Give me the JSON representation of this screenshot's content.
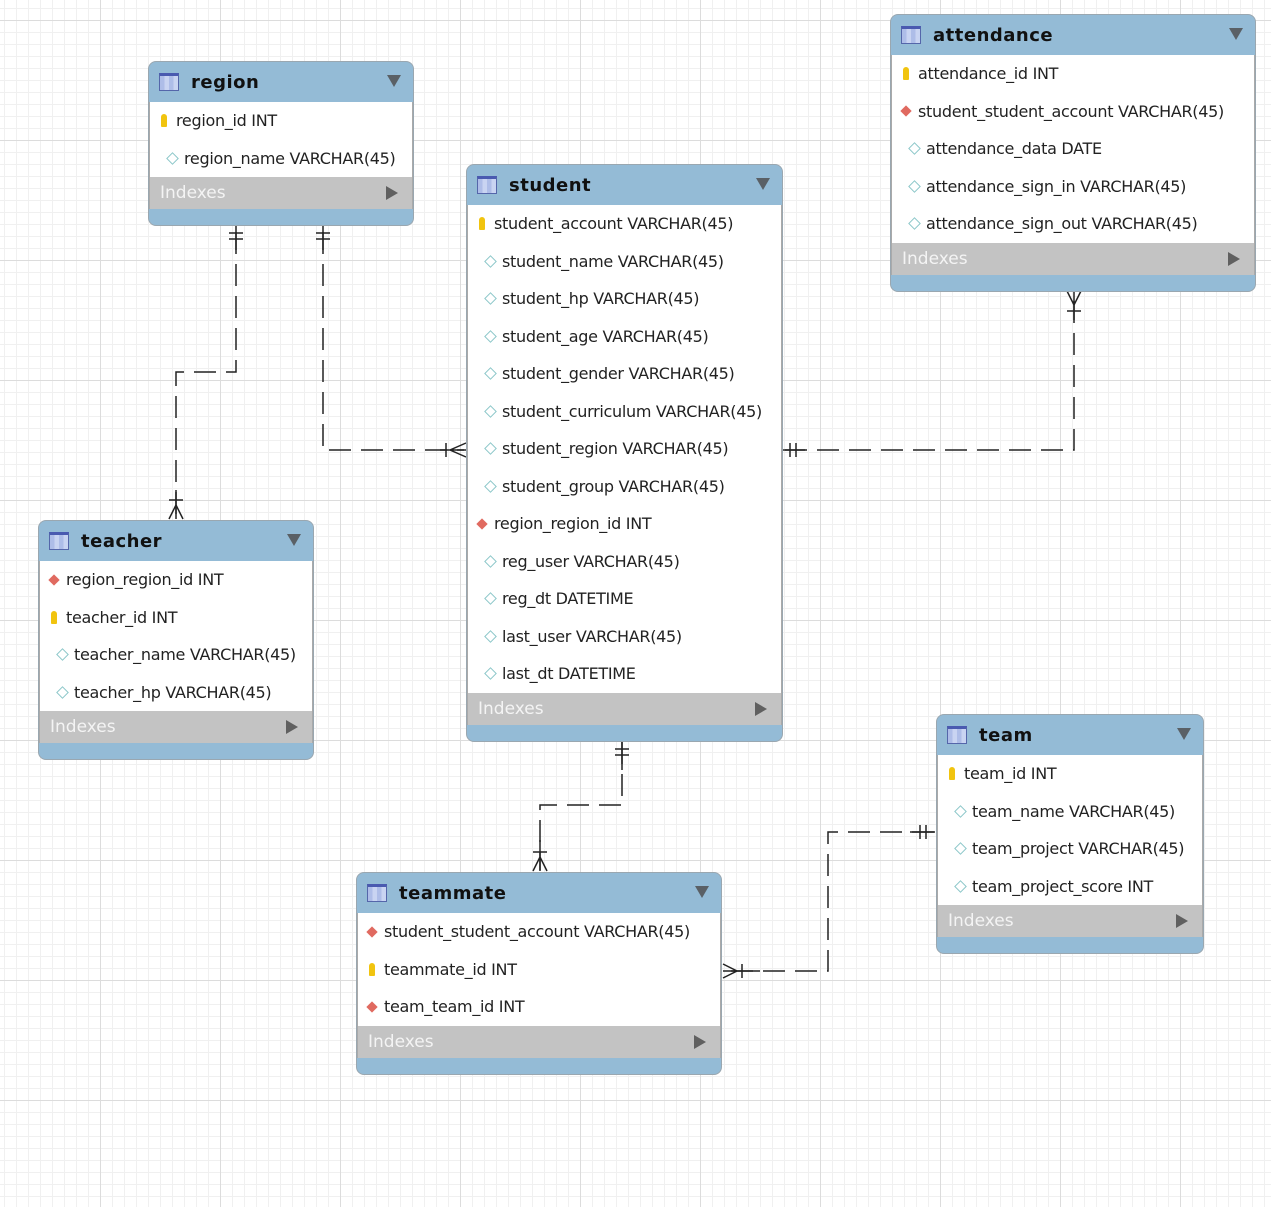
{
  "tables": [
    {
      "id": "region",
      "name": "region",
      "indexes_label": "Indexes",
      "columns": [
        {
          "icon": "key",
          "text": "region_id INT"
        },
        {
          "icon": "column",
          "text": "region_name VARCHAR(45)"
        }
      ]
    },
    {
      "id": "student",
      "name": "student",
      "indexes_label": "Indexes",
      "columns": [
        {
          "icon": "key",
          "text": "student_account VARCHAR(45)"
        },
        {
          "icon": "column",
          "text": "student_name VARCHAR(45)"
        },
        {
          "icon": "column",
          "text": "student_hp VARCHAR(45)"
        },
        {
          "icon": "column",
          "text": "student_age VARCHAR(45)"
        },
        {
          "icon": "column",
          "text": "student_gender VARCHAR(45)"
        },
        {
          "icon": "column",
          "text": "student_curriculum VARCHAR(45)"
        },
        {
          "icon": "column",
          "text": "student_region VARCHAR(45)"
        },
        {
          "icon": "column",
          "text": "student_group VARCHAR(45)"
        },
        {
          "icon": "foreign-key",
          "text": "region_region_id INT"
        },
        {
          "icon": "column",
          "text": "reg_user VARCHAR(45)"
        },
        {
          "icon": "column",
          "text": "reg_dt DATETIME"
        },
        {
          "icon": "column",
          "text": "last_user VARCHAR(45)"
        },
        {
          "icon": "column",
          "text": "last_dt DATETIME"
        }
      ]
    },
    {
      "id": "attendance",
      "name": "attendance",
      "indexes_label": "Indexes",
      "columns": [
        {
          "icon": "key",
          "text": "attendance_id INT"
        },
        {
          "icon": "foreign-key",
          "text": "student_student_account VARCHAR(45)"
        },
        {
          "icon": "column",
          "text": "attendance_data DATE"
        },
        {
          "icon": "column",
          "text": "attendance_sign_in VARCHAR(45)"
        },
        {
          "icon": "column",
          "text": "attendance_sign_out VARCHAR(45)"
        }
      ]
    },
    {
      "id": "teacher",
      "name": "teacher",
      "indexes_label": "Indexes",
      "columns": [
        {
          "icon": "foreign-key",
          "text": "region_region_id INT"
        },
        {
          "icon": "key",
          "text": "teacher_id INT"
        },
        {
          "icon": "column",
          "text": "teacher_name VARCHAR(45)"
        },
        {
          "icon": "column",
          "text": "teacher_hp VARCHAR(45)"
        }
      ]
    },
    {
      "id": "team",
      "name": "team",
      "indexes_label": "Indexes",
      "columns": [
        {
          "icon": "key",
          "text": "team_id INT"
        },
        {
          "icon": "column",
          "text": "team_name VARCHAR(45)"
        },
        {
          "icon": "column",
          "text": "team_project VARCHAR(45)"
        },
        {
          "icon": "column",
          "text": "team_project_score INT"
        }
      ]
    },
    {
      "id": "teammate",
      "name": "teammate",
      "indexes_label": "Indexes",
      "columns": [
        {
          "icon": "foreign-key",
          "text": "student_student_account VARCHAR(45)"
        },
        {
          "icon": "key",
          "text": "teammate_id INT"
        },
        {
          "icon": "foreign-key",
          "text": "team_team_id INT"
        }
      ]
    }
  ],
  "relationships": [
    {
      "from": "region",
      "to": "teacher",
      "type": "one-to-many"
    },
    {
      "from": "region",
      "to": "student",
      "type": "one-to-many"
    },
    {
      "from": "student",
      "to": "attendance",
      "type": "one-to-many"
    },
    {
      "from": "student",
      "to": "teammate",
      "type": "one-to-many"
    },
    {
      "from": "team",
      "to": "teammate",
      "type": "one-to-many"
    }
  ],
  "colors": {
    "header": "#94bbd6",
    "indexes_bar": "#c3c3c3",
    "key": "#f1c40f",
    "foreign_key": "#e06a60",
    "column": "#8cc7c9"
  }
}
